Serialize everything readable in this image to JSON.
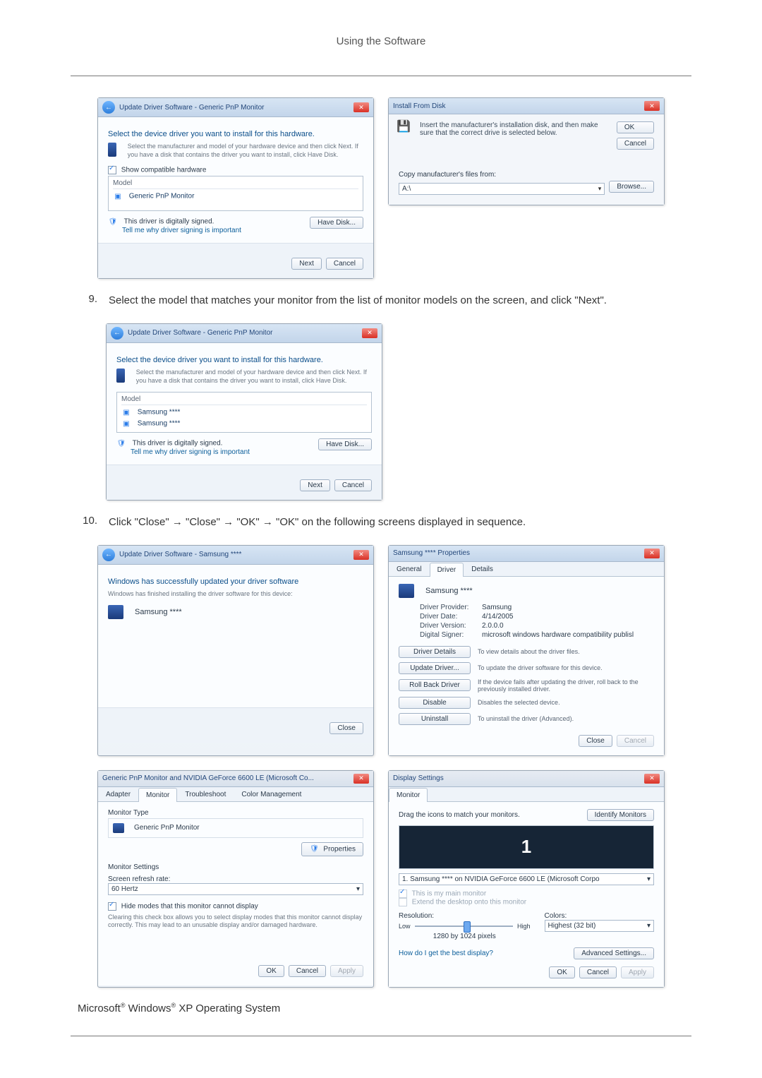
{
  "page_header": "Using the Software",
  "step9": {
    "num": "9.",
    "text": "Select the model that matches your monitor from the list of monitor models on the screen, and click \"Next\"."
  },
  "step10": {
    "num": "10.",
    "text": "Click \"Close\" → \"Close\" → \"OK\" → \"OK\" on the following screens displayed in sequence."
  },
  "dlg_update_generic": {
    "title": "Update Driver Software - Generic PnP Monitor",
    "heading": "Select the device driver you want to install for this hardware.",
    "subtext": "Select the manufacturer and model of your hardware device and then click Next. If you have a disk that contains the driver you want to install, click Have Disk.",
    "show_compat_label": "Show compatible hardware",
    "list_hdr": "Model",
    "list_item": "Generic PnP Monitor",
    "signed": "This driver is digitally signed.",
    "tell_me": "Tell me why driver signing is important",
    "have_disk": "Have Disk...",
    "next": "Next",
    "cancel": "Cancel"
  },
  "dlg_install_disk": {
    "title": "Install From Disk",
    "instruct": "Insert the manufacturer's installation disk, and then make sure that the correct drive is selected below.",
    "ok": "OK",
    "cancel": "Cancel",
    "copy_label": "Copy manufacturer's files from:",
    "combo_value": "A:\\",
    "browse": "Browse..."
  },
  "dlg_update_model": {
    "title": "Update Driver Software - Generic PnP Monitor",
    "heading": "Select the device driver you want to install for this hardware.",
    "subtext": "Select the manufacturer and model of your hardware device and then click Next. If you have a disk that contains the driver you want to install, click Have Disk.",
    "list_hdr": "Model",
    "item1": "Samsung ****",
    "item2": "Samsung ****",
    "signed": "This driver is digitally signed.",
    "tell_me": "Tell me why driver signing is important",
    "have_disk": "Have Disk...",
    "next": "Next",
    "cancel": "Cancel"
  },
  "dlg_update_done": {
    "title": "Update Driver Software - Samsung ****",
    "heading": "Windows has successfully updated your driver software",
    "subtext": "Windows has finished installing the driver software for this device:",
    "item": "Samsung ****",
    "close": "Close"
  },
  "dlg_props": {
    "title": "Samsung **** Properties",
    "tabs": {
      "general": "General",
      "driver": "Driver",
      "details": "Details"
    },
    "device": "Samsung ****",
    "kv": {
      "provider_k": "Driver Provider:",
      "provider_v": "Samsung",
      "date_k": "Driver Date:",
      "date_v": "4/14/2005",
      "version_k": "Driver Version:",
      "version_v": "2.0.0.0",
      "signer_k": "Digital Signer:",
      "signer_v": "microsoft windows hardware compatibility publisl"
    },
    "btns": {
      "details": "Driver Details",
      "details_d": "To view details about the driver files.",
      "update": "Update Driver...",
      "update_d": "To update the driver software for this device.",
      "rollback": "Roll Back Driver",
      "rollback_d": "If the device fails after updating the driver, roll back to the previously installed driver.",
      "disable": "Disable",
      "disable_d": "Disables the selected device.",
      "uninstall": "Uninstall",
      "uninstall_d": "To uninstall the driver (Advanced)."
    },
    "close": "Close",
    "cancel": "Cancel"
  },
  "dlg_monprops": {
    "title": "Generic PnP Monitor and NVIDIA GeForce 6600 LE (Microsoft Co...",
    "tabs": {
      "adapter": "Adapter",
      "monitor": "Monitor",
      "trouble": "Troubleshoot",
      "color": "Color Management"
    },
    "montype_hdr": "Monitor Type",
    "montype_val": "Generic PnP Monitor",
    "properties": "Properties",
    "settings_hdr": "Monitor Settings",
    "refresh_lbl": "Screen refresh rate:",
    "refresh_val": "60 Hertz",
    "hide_modes": "Hide modes that this monitor cannot display",
    "hide_note": "Clearing this check box allows you to select display modes that this monitor cannot display correctly. This may lead to an unusable display and/or damaged hardware.",
    "ok": "OK",
    "cancel": "Cancel",
    "apply": "Apply"
  },
  "dlg_display": {
    "title": "Display Settings",
    "tab": "Monitor",
    "drag": "Drag the icons to match your monitors.",
    "identify": "Identify Monitors",
    "mon_num": "1",
    "select_val": "1. Samsung **** on NVIDIA GeForce 6600 LE (Microsoft Corpo",
    "this_main": "This is my main monitor",
    "extend": "Extend the desktop onto this monitor",
    "res_lbl": "Resolution:",
    "low": "Low",
    "high": "High",
    "res_val": "1280 by 1024 pixels",
    "colors_lbl": "Colors:",
    "colors_val": "Highest (32 bit)",
    "best_link": "How do I get the best display?",
    "advanced": "Advanced Settings...",
    "ok": "OK",
    "cancel": "Cancel",
    "apply": "Apply"
  },
  "footnote": {
    "p1": "Microsoft",
    "p2": " Windows",
    "p3": " XP Operating System",
    "reg": "®"
  }
}
